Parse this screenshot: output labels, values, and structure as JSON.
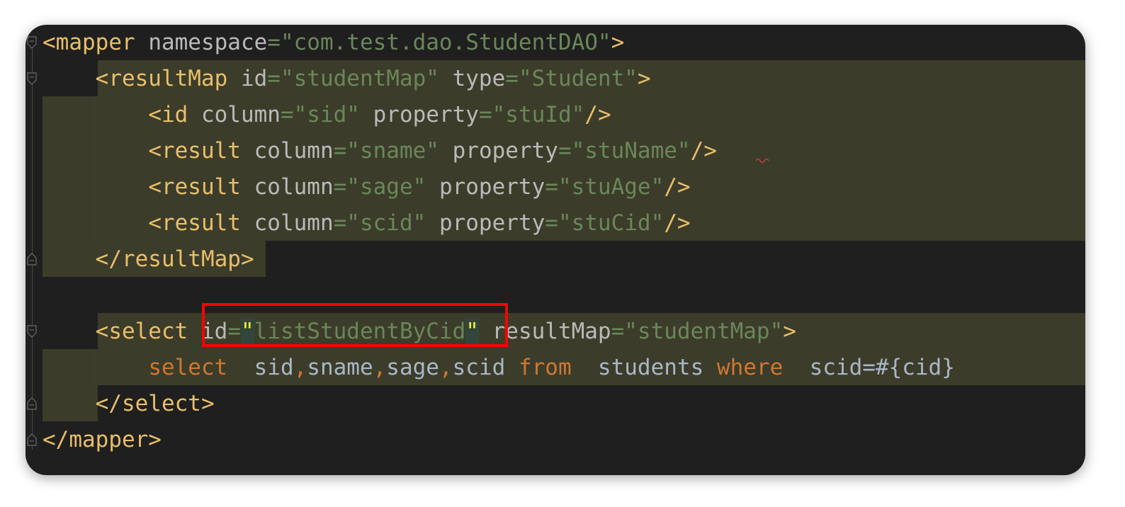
{
  "editor": {
    "lines": [
      {
        "tokens": [
          {
            "t": "<mapper",
            "c": "tag"
          },
          {
            "t": " namespace",
            "c": "attr"
          },
          {
            "t": "=",
            "c": "eq"
          },
          {
            "t": "\"com.test.dao.StudentDAO\"",
            "c": "str"
          },
          {
            "t": ">",
            "c": "tag"
          }
        ]
      },
      {
        "tokens": [
          {
            "t": "    "
          },
          {
            "t": "<resultMap",
            "c": "tag"
          },
          {
            "t": " id",
            "c": "attr"
          },
          {
            "t": "=",
            "c": "eq"
          },
          {
            "t": "\"studentMap\"",
            "c": "str"
          },
          {
            "t": " type",
            "c": "attr"
          },
          {
            "t": "=",
            "c": "eq"
          },
          {
            "t": "\"Student\"",
            "c": "str"
          },
          {
            "t": ">",
            "c": "tag"
          }
        ]
      },
      {
        "tokens": [
          {
            "t": "        "
          },
          {
            "t": "<id",
            "c": "tag"
          },
          {
            "t": " column",
            "c": "attr"
          },
          {
            "t": "=",
            "c": "eq"
          },
          {
            "t": "\"sid\"",
            "c": "str"
          },
          {
            "t": " property",
            "c": "attr"
          },
          {
            "t": "=",
            "c": "eq"
          },
          {
            "t": "\"stuId\"",
            "c": "str"
          },
          {
            "t": "/>",
            "c": "tag"
          }
        ]
      },
      {
        "tokens": [
          {
            "t": "        "
          },
          {
            "t": "<result",
            "c": "tag"
          },
          {
            "t": " column",
            "c": "attr"
          },
          {
            "t": "=",
            "c": "eq"
          },
          {
            "t": "\"sname\"",
            "c": "str"
          },
          {
            "t": " property",
            "c": "attr"
          },
          {
            "t": "=",
            "c": "eq"
          },
          {
            "t": "\"stuName\"",
            "c": "str"
          },
          {
            "t": "/>",
            "c": "tag"
          }
        ]
      },
      {
        "tokens": [
          {
            "t": "        "
          },
          {
            "t": "<result",
            "c": "tag"
          },
          {
            "t": " column",
            "c": "attr"
          },
          {
            "t": "=",
            "c": "eq"
          },
          {
            "t": "\"sage\"",
            "c": "str"
          },
          {
            "t": " property",
            "c": "attr"
          },
          {
            "t": "=",
            "c": "eq"
          },
          {
            "t": "\"stuAge\"",
            "c": "str"
          },
          {
            "t": "/>",
            "c": "tag"
          }
        ]
      },
      {
        "tokens": [
          {
            "t": "        "
          },
          {
            "t": "<result",
            "c": "tag"
          },
          {
            "t": " column",
            "c": "attr"
          },
          {
            "t": "=",
            "c": "eq"
          },
          {
            "t": "\"scid\"",
            "c": "str"
          },
          {
            "t": " property",
            "c": "attr"
          },
          {
            "t": "=",
            "c": "eq"
          },
          {
            "t": "\"stuCid\"",
            "c": "str"
          },
          {
            "t": "/>",
            "c": "tag"
          }
        ]
      },
      {
        "tokens": [
          {
            "t": "    "
          },
          {
            "t": "</resultMap>",
            "c": "tag"
          }
        ]
      },
      {
        "tokens": []
      },
      {
        "tokens": [
          {
            "t": "    "
          },
          {
            "t": "<select",
            "c": "tag"
          },
          {
            "t": " id",
            "c": "attr"
          },
          {
            "t": "=",
            "c": "eq"
          },
          {
            "t": "\"",
            "c": "quote-hl"
          },
          {
            "t": "listStudentByCid",
            "c": "str"
          },
          {
            "t": "\"",
            "c": "quote-hl"
          },
          {
            "t": " resultMap",
            "c": "attr"
          },
          {
            "t": "=",
            "c": "eq"
          },
          {
            "t": "\"studentMap\"",
            "c": "str"
          },
          {
            "t": ">",
            "c": "tag"
          }
        ]
      },
      {
        "tokens": [
          {
            "t": "        "
          },
          {
            "t": "select",
            "c": "kw"
          },
          {
            "t": "  sid",
            "c": "plain"
          },
          {
            "t": ",",
            "c": "comma"
          },
          {
            "t": "sname",
            "c": "plain"
          },
          {
            "t": ",",
            "c": "comma"
          },
          {
            "t": "sage",
            "c": "plain"
          },
          {
            "t": ",",
            "c": "comma"
          },
          {
            "t": "scid ",
            "c": "plain"
          },
          {
            "t": "from",
            "c": "kw"
          },
          {
            "t": "  students ",
            "c": "plain"
          },
          {
            "t": "where",
            "c": "kw"
          },
          {
            "t": "  scid=#{cid}",
            "c": "plain"
          }
        ]
      },
      {
        "tokens": [
          {
            "t": "    "
          },
          {
            "t": "</select>",
            "c": "tag"
          }
        ]
      },
      {
        "tokens": [
          {
            "t": "</mapper>",
            "c": "tag"
          }
        ]
      }
    ]
  },
  "colors": {
    "background": "#1f1f1f",
    "tag": "#e8bf6a",
    "attribute": "#bababa",
    "string": "#6a8759",
    "keyword": "#cc7832",
    "highlight_box": "#ff0000"
  }
}
